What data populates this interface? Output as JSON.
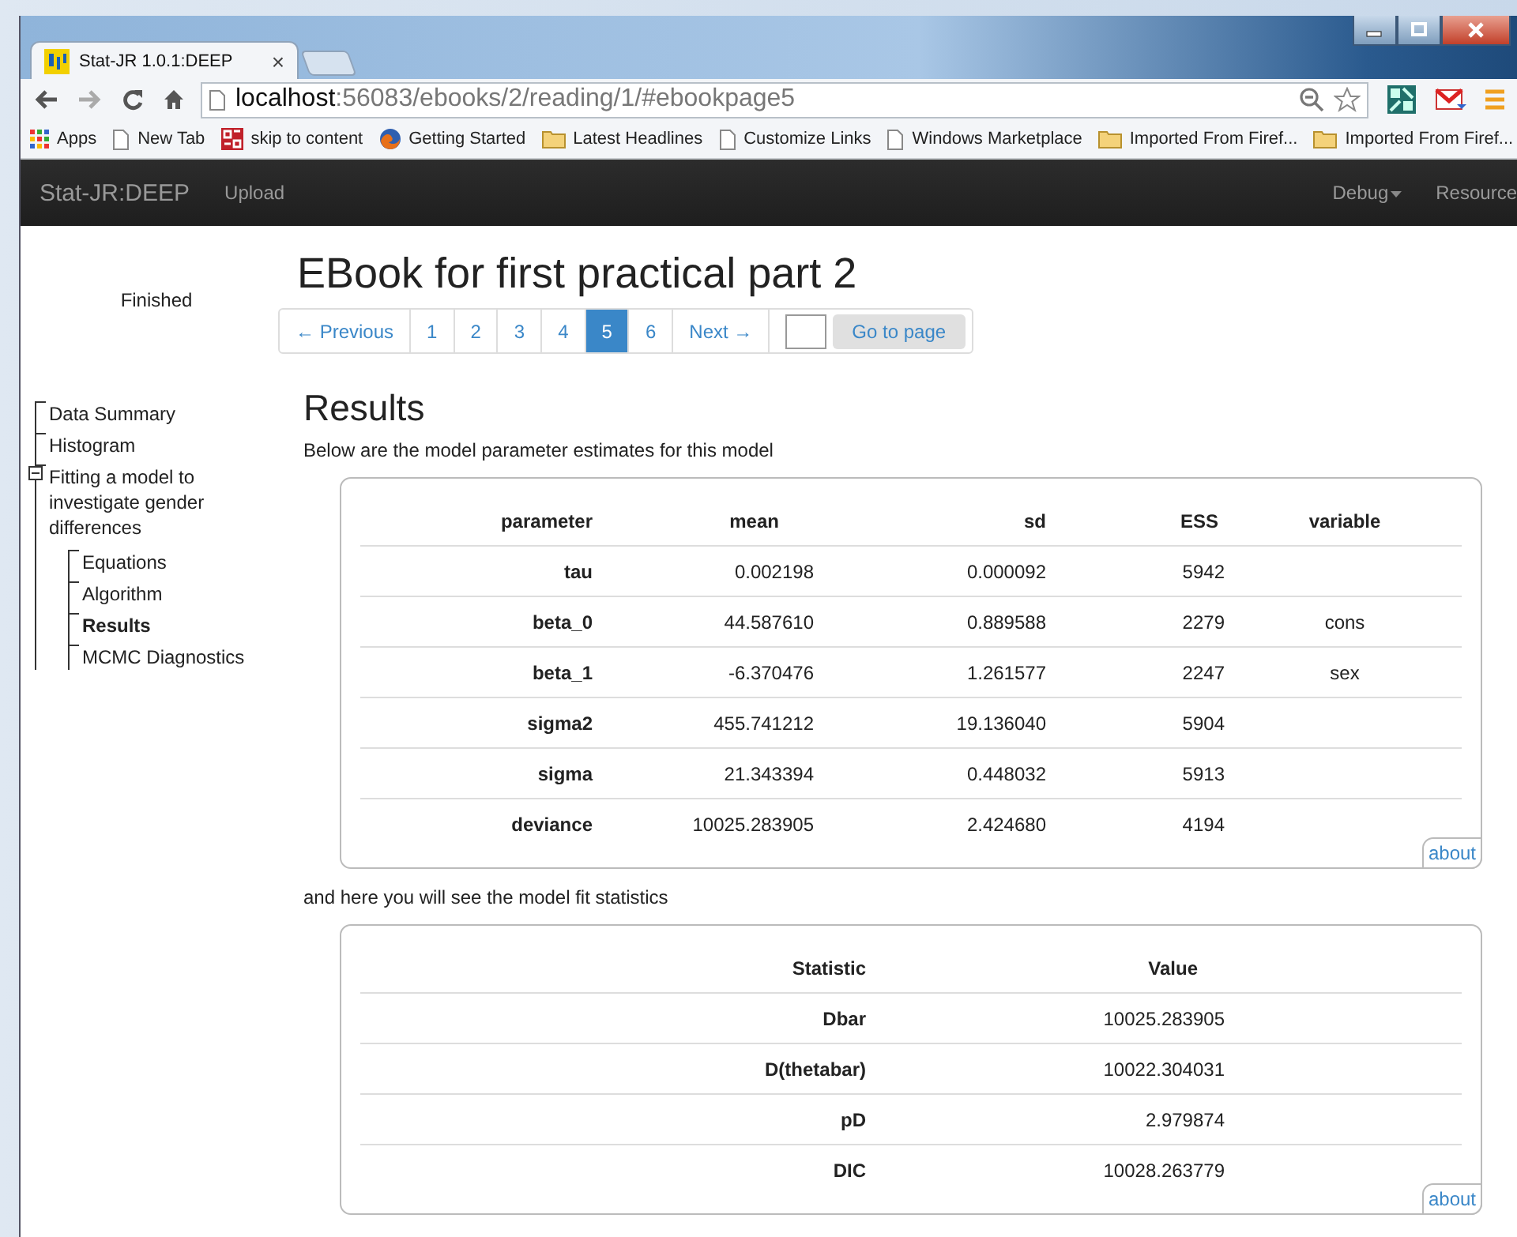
{
  "browser": {
    "tab_title": "Stat-JR 1.0.1:DEEP",
    "tab_close": "×",
    "address_host": "localhost",
    "address_rest": ":56083/ebooks/2/reading/1/#ebookpage5",
    "bookmarks": [
      {
        "label": "Apps",
        "kind": "apps"
      },
      {
        "label": "New Tab",
        "kind": "page"
      },
      {
        "label": "skip to content",
        "kind": "site"
      },
      {
        "label": "Getting Started",
        "kind": "firefox"
      },
      {
        "label": "Latest Headlines",
        "kind": "folder"
      },
      {
        "label": "Customize Links",
        "kind": "page"
      },
      {
        "label": "Windows Marketplace",
        "kind": "page"
      },
      {
        "label": "Imported From Firef...",
        "kind": "folder"
      },
      {
        "label": "Imported From Firef...",
        "kind": "folder"
      }
    ]
  },
  "navbar": {
    "brand": "Stat-JR:DEEP",
    "links": [
      "Upload"
    ],
    "right_links": [
      {
        "label": "Debug",
        "dropdown": true
      },
      {
        "label": "Resource",
        "dropdown": false
      }
    ]
  },
  "sidebar": {
    "status": "Finished",
    "tree": [
      {
        "label": "Data Summary",
        "selected": false
      },
      {
        "label": "Histogram",
        "selected": false
      },
      {
        "label": "Fitting a model to investigate gender differences",
        "selected": false,
        "expanded": true,
        "children": [
          {
            "label": "Equations",
            "selected": false
          },
          {
            "label": "Algorithm",
            "selected": false
          },
          {
            "label": "Results",
            "selected": true
          },
          {
            "label": "MCMC Diagnostics",
            "selected": false
          }
        ]
      }
    ]
  },
  "title": "EBook for first practical part 2",
  "pagination": {
    "previous": "← Previous",
    "pages": [
      {
        "label": "1",
        "selected": false
      },
      {
        "label": "2",
        "selected": false
      },
      {
        "label": "3",
        "selected": false
      },
      {
        "label": "4",
        "selected": false
      },
      {
        "label": "5",
        "selected": true
      },
      {
        "label": "6",
        "selected": false
      }
    ],
    "next": "Next →",
    "goto_button": "Go to page"
  },
  "heading": "Results",
  "intro": "Below are the model parameter estimates for this model",
  "parameters_table": {
    "columns": [
      "parameter",
      "mean",
      "sd",
      "ESS",
      "variable"
    ],
    "rows": [
      [
        "tau",
        "0.002198",
        "0.000092",
        "5942",
        ""
      ],
      [
        "beta_0",
        "44.587610",
        "0.889588",
        "2279",
        "cons"
      ],
      [
        "beta_1",
        "-6.370476",
        "1.261577",
        "2247",
        "sex"
      ],
      [
        "sigma2",
        "455.741212",
        "19.136040",
        "5904",
        ""
      ],
      [
        "sigma",
        "21.343394",
        "0.448032",
        "5913",
        ""
      ],
      [
        "deviance",
        "10025.283905",
        "2.424680",
        "4194",
        ""
      ]
    ],
    "about": "about"
  },
  "fit_text": "and here you will see the model fit statistics",
  "fit_table": {
    "columns": [
      "Statistic",
      "Value"
    ],
    "rows": [
      [
        "Dbar",
        "10025.283905"
      ],
      [
        "D(thetabar)",
        "10022.304031"
      ],
      [
        "pD",
        "2.979874"
      ],
      [
        "DIC",
        "10028.263779"
      ]
    ],
    "about": "about"
  }
}
